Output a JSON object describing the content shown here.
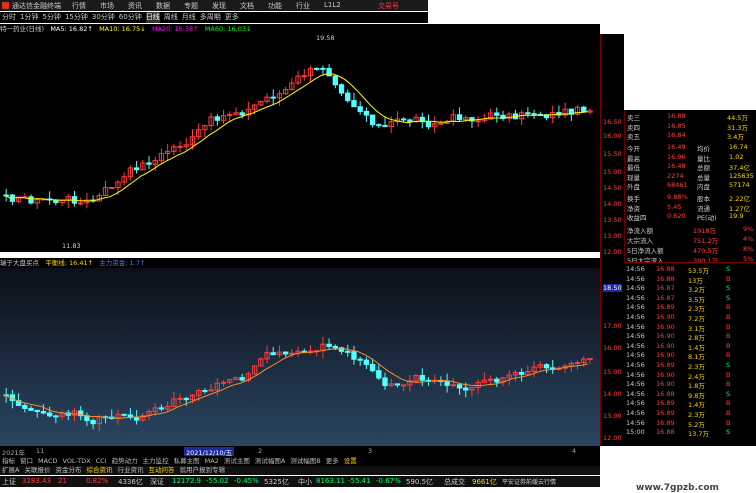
{
  "titlebar": {
    "app_name": "通达信金融终端",
    "menus": [
      "行情",
      "市场",
      "资讯",
      "数据",
      "专题",
      "发现",
      "文档",
      "功能",
      "行业",
      "L1L2"
    ],
    "right_label": "交易号"
  },
  "periods": [
    "分时",
    "1分钟",
    "5分钟",
    "15分钟",
    "30分钟",
    "60分钟",
    "日线",
    "周线",
    "月线",
    "多周期",
    "更多"
  ],
  "active_period": "日线",
  "stockbar": {
    "name": "特一药业(日线)",
    "ma5": "MA5: 16.82↑",
    "ma10": "MA10: 16.75↓",
    "ma20": "MA20: 16.38↑",
    "ma60": "MA60: 16.03↓"
  },
  "scale_labels": [
    "16.50",
    "16.00",
    "15.50",
    "15.00",
    "14.50",
    "14.00",
    "13.50",
    "13.00",
    "12.50",
    "12.00",
    "18.50",
    "17.00",
    "16.00",
    "15.00",
    "14.00",
    "13.00",
    "12.00"
  ],
  "annotations": {
    "high": "19.58",
    "low": "11.83"
  },
  "sub_title": {
    "name": "瑞于大盘买点",
    "val1": "平衡线: 16.41↑",
    "val2": "主力资金: 1.7↑"
  },
  "xaxis": {
    "year": "2021年",
    "mark1": "11",
    "date_highlight": "2021/12/10/五",
    "mark2": "2",
    "mark3": "3",
    "mark4": "4"
  },
  "quote": {
    "rows": [
      {
        "k": "卖三",
        "v": "16.88",
        "n": "44.5万"
      },
      {
        "k": "卖四",
        "v": "16.85",
        "n": "31.3万"
      },
      {
        "k": "卖五",
        "v": "16.84",
        "n": "3.4万"
      },
      {
        "k": "今开",
        "v": "16.49",
        "k2": "均价",
        "v2": "16.74"
      },
      {
        "k": "最高",
        "v": "16.96",
        "k2": "量比",
        "v2": "1.02"
      },
      {
        "k": "最低",
        "v": "16.48",
        "k2": "总额",
        "v2": "37.4亿"
      },
      {
        "k": "现量",
        "v": "2274",
        "k2": "总量",
        "v2": "125635"
      },
      {
        "k": "外盘",
        "v": "68461",
        "k2": "内盘",
        "v2": "57174"
      },
      {
        "k": "换手",
        "v": "9.88%",
        "k2": "股本",
        "v2": "2.22亿"
      },
      {
        "k": "净资",
        "v": "5.45",
        "k2": "流通",
        "v2": "1.27亿"
      },
      {
        "k": "收益四",
        "v": "0.620",
        "k2": "PE(动)",
        "v2": "19.9"
      }
    ],
    "flow": [
      {
        "k": "净流入额",
        "v": "1918万",
        "p": "9%"
      },
      {
        "k": "大宗流入",
        "v": "751.2万",
        "p": "4%"
      },
      {
        "k": "5日净流入额",
        "v": "470.5万",
        "p": "8%"
      },
      {
        "k": "5日大宗流入",
        "v": "390.1万",
        "p": "5%"
      }
    ]
  },
  "ticks": [
    {
      "t": "14:56",
      "p": "16.88",
      "v": "53.5万",
      "s": "S"
    },
    {
      "t": "14:56",
      "p": "16.88",
      "v": "13万",
      "s": "B"
    },
    {
      "t": "14:56",
      "p": "16.87",
      "v": "3.2万",
      "s": "S"
    },
    {
      "t": "14:56",
      "p": "16.87",
      "v": "3.5万",
      "s": "S"
    },
    {
      "t": "14:56",
      "p": "16.89",
      "v": "2.3万",
      "s": "B"
    },
    {
      "t": "14:56",
      "p": "16.90",
      "v": "7.2万",
      "s": "B"
    },
    {
      "t": "14:56",
      "p": "16.90",
      "v": "3.1万",
      "s": "B"
    },
    {
      "t": "14:56",
      "p": "16.90",
      "v": "2.8万",
      "s": "B"
    },
    {
      "t": "14:56",
      "p": "16.90",
      "v": "1.4万",
      "s": "B"
    },
    {
      "t": "14:56",
      "p": "16.90",
      "v": "8.1万",
      "s": "B"
    },
    {
      "t": "14:56",
      "p": "16.89",
      "v": "2.3万",
      "s": "S"
    },
    {
      "t": "14:56",
      "p": "16.90",
      "v": "2.4万",
      "s": "B"
    },
    {
      "t": "14:56",
      "p": "16.90",
      "v": "1.8万",
      "s": "B"
    },
    {
      "t": "14:56",
      "p": "16.88",
      "v": "9.8万",
      "s": "S"
    },
    {
      "t": "14:56",
      "p": "16.89",
      "v": "1.4万",
      "s": "B"
    },
    {
      "t": "14:56",
      "p": "16.89",
      "v": "2.3万",
      "s": "B"
    },
    {
      "t": "14:56",
      "p": "16.89",
      "v": "5.2万",
      "s": "B"
    },
    {
      "t": "15:00",
      "p": "16.88",
      "v": "13.7万",
      "s": "S"
    }
  ],
  "tabs": [
    "指标",
    "窗口",
    "MACD",
    "VOL-TDX",
    "CCI",
    "趋势动力",
    "主力监控",
    "私募主图",
    "MA2",
    "测试主图",
    "测试幅图A",
    "测试幅图B",
    "更多",
    "设置"
  ],
  "toolbar2": [
    "扩展A",
    "关联报价",
    "资金分布",
    "综合资讯",
    "行业资讯",
    "互动问答",
    "翁用户报到专辑"
  ],
  "status": {
    "sh_name": "上证",
    "sh_val": "3283.43",
    "sh_chg": "21",
    "sh_pct": "0.82%",
    "sh_amt": "4336亿",
    "sz_name": "深证",
    "sz_val": "12172.9",
    "sz_chg": "-55.02",
    "sz_pct": "-0.45%",
    "sz_amt": "5325亿",
    "zx_name": "中小",
    "zx_val": "8163.11",
    "zx_chg": "-55.41",
    "zx_pct": "-0.67%",
    "zx_amt": "590.5亿",
    "total_label": "总成交",
    "total_val": "9661亿",
    "server": "平安证券前缓云行情"
  },
  "watermark": "www.7gpzb.com",
  "colors": {
    "up": "#ff3b3b",
    "down": "#54ffff",
    "ma5": "#ffffff",
    "ma10": "#ffff00",
    "ma20": "#ff00ff",
    "ma60": "#00ff00"
  }
}
